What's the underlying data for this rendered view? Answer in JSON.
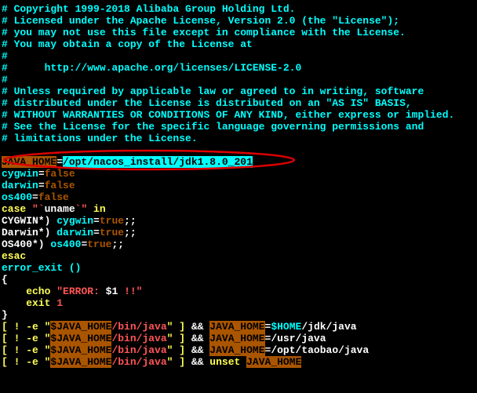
{
  "license": {
    "l1": "# Copyright 1999-2018 Alibaba Group Holding Ltd.",
    "l2": "# Licensed under the Apache License, Version 2.0 (the \"License\");",
    "l3": "# you may not use this file except in compliance with the License.",
    "l4": "# You may obtain a copy of the License at",
    "l5": "#",
    "l6": "#      http://www.apache.org/licenses/LICENSE-2.0",
    "l7": "#",
    "l8": "# Unless required by applicable law or agreed to in writing, software",
    "l9": "# distributed under the License is distributed on an \"AS IS\" BASIS,",
    "l10": "# WITHOUT WARRANTIES OR CONDITIONS OF ANY KIND, either express or implied.",
    "l11": "# See the License for the specific language governing permissions and",
    "l12": "# limitations under the License."
  },
  "java_home": {
    "var": "JAVA_HOME",
    "eq": "=",
    "val": "/opt/nacos_install/jdk1.8.0_201"
  },
  "vars": {
    "cygwin_k": "cygwin",
    "cygwin_v": "false",
    "darwin_k": "darwin",
    "darwin_v": "false",
    "os400_k": "os400",
    "os400_v": "false",
    "eq": "="
  },
  "case": {
    "kw_case": "case",
    "q1": " \"`",
    "uname": "uname",
    "q2": "`\" ",
    "kw_in": "in",
    "l1a": "CYGWIN*) ",
    "l1b": "cygwin",
    "l1c": "=",
    "l1d": "true",
    "l1e": ";;",
    "l2a": "Darwin*) ",
    "l2b": "darwin",
    "l2c": "=",
    "l2d": "true",
    "l2e": ";;",
    "l3a": "OS400*) ",
    "l3b": "os400",
    "l3c": "=",
    "l3d": "true",
    "l3e": ";;",
    "esac": "esac"
  },
  "fn": {
    "name": "error_exit ()",
    "open": "{",
    "echo_kw": "echo",
    "echo_sp": " ",
    "echo_q1": "\"ERROR: ",
    "echo_var": "$1",
    "echo_q2": " !!\"",
    "exit_kw": "exit",
    "exit_sp": " ",
    "exit_code": "1",
    "close": "}"
  },
  "tests": {
    "pre": "[ ! -e \"",
    "var": "$JAVA_HOME",
    "bin": "/bin/java",
    "post": "\" ] ",
    "amp": "&&",
    "sp": " ",
    "jh": "JAVA_HOME",
    "eq": "=",
    "r1a": "$HOME",
    "r1b": "/jdk/java",
    "r2": "/usr/java",
    "r3": "/opt/taobao/java",
    "unset": "unset",
    "sp2": " "
  }
}
